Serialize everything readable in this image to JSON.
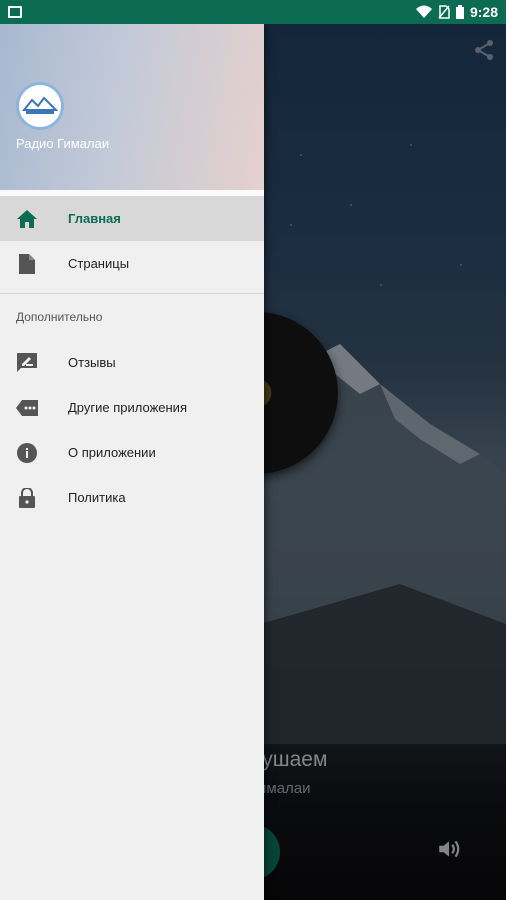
{
  "status_bar": {
    "time": "9:28"
  },
  "drawer": {
    "app_name": "Радио Гималаи",
    "items": [
      {
        "label": "Главная",
        "icon": "home-icon",
        "active": true
      },
      {
        "label": "Страницы",
        "icon": "document-icon",
        "active": false
      }
    ],
    "section_title": "Дополнительно",
    "extra_items": [
      {
        "label": "Отзывы",
        "icon": "feedback-icon"
      },
      {
        "label": "Другие приложения",
        "icon": "label-tag-icon"
      },
      {
        "label": "О приложении",
        "icon": "info-icon"
      },
      {
        "label": "Политика",
        "icon": "lock-icon"
      }
    ]
  },
  "player": {
    "title_fragment": "лушаем",
    "subtitle_fragment": "ималаи"
  },
  "colors": {
    "accent": "#0c6b53",
    "status_bar": "#0c6b53",
    "drawer_bg": "#f0f0f0"
  }
}
